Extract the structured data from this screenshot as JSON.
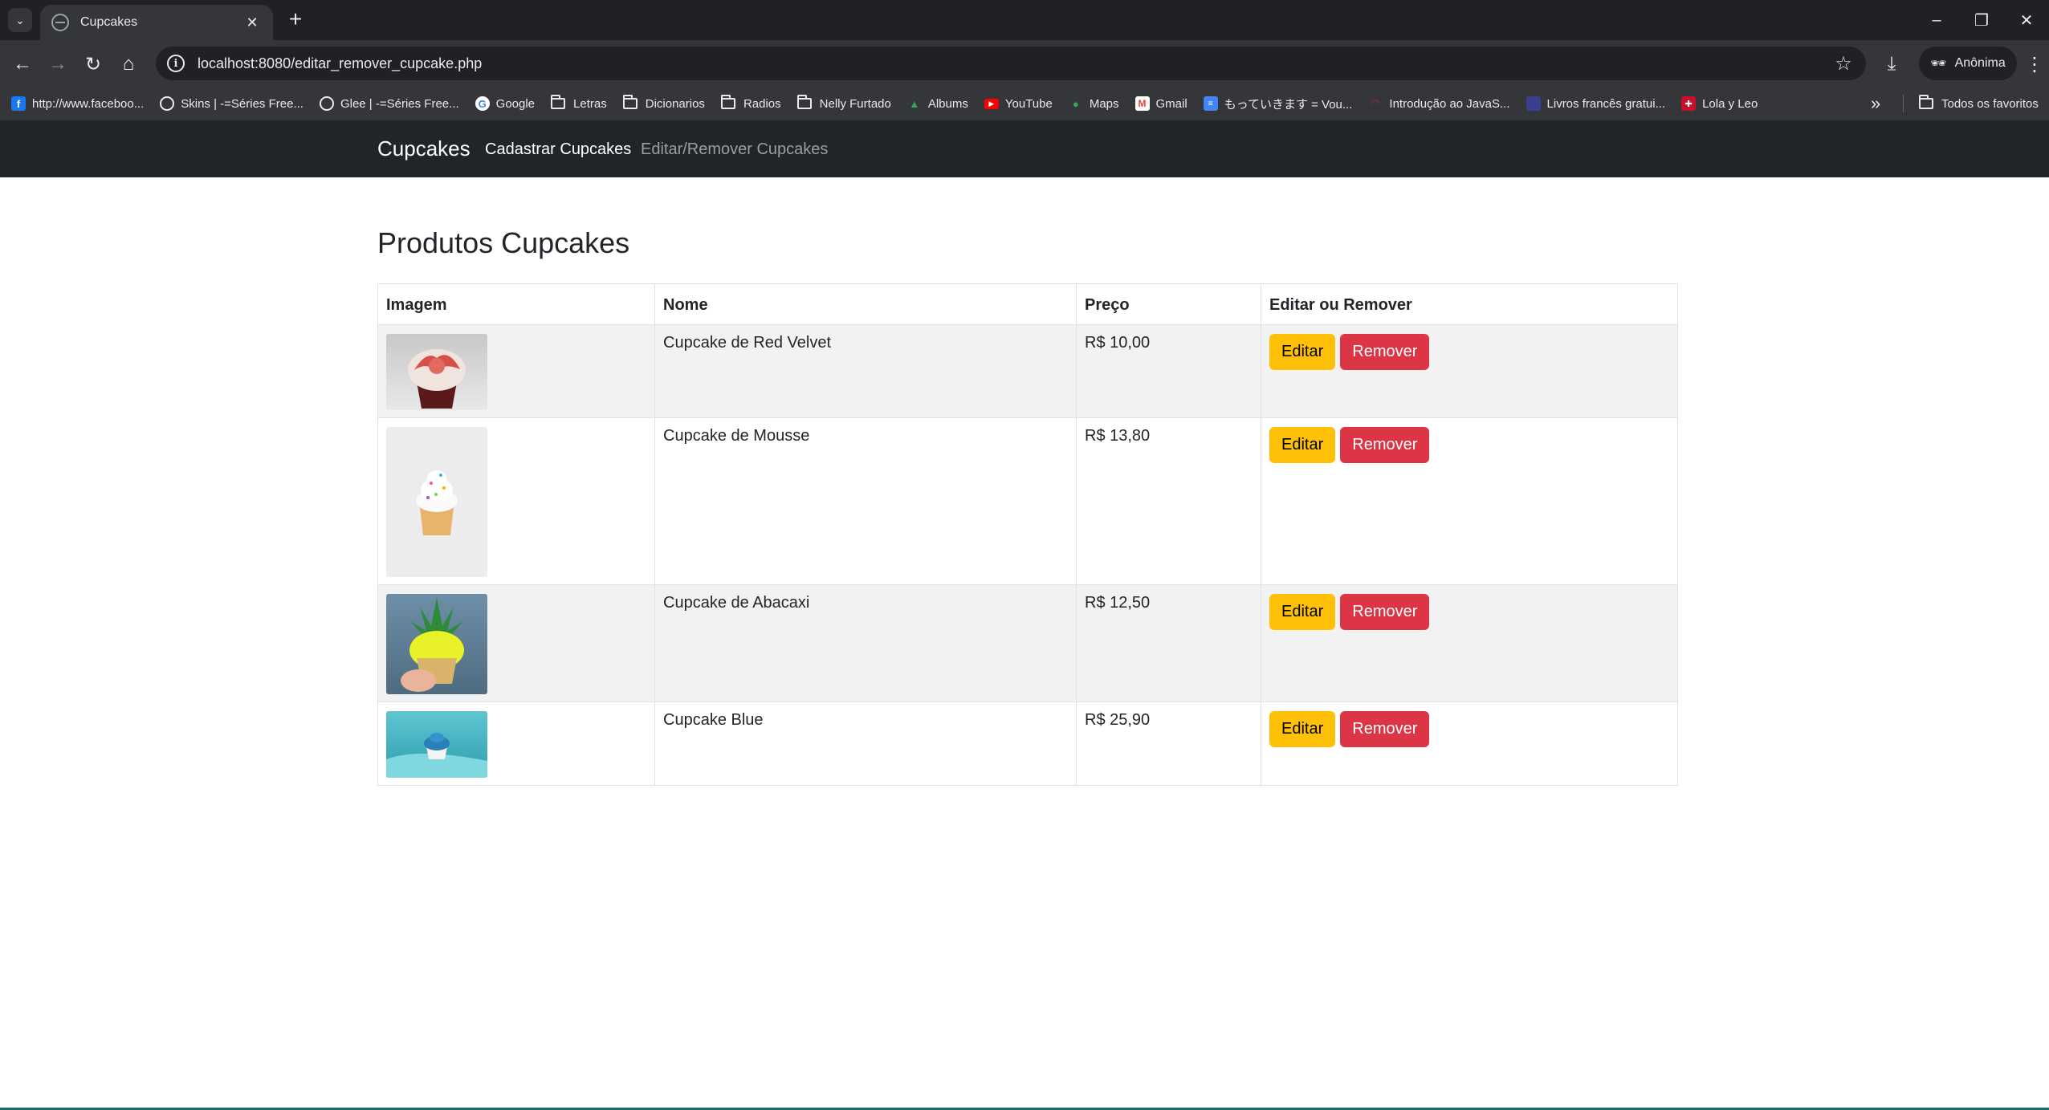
{
  "browser": {
    "tab_title": "Cupcakes",
    "tab_close": "✕",
    "new_tab": "+",
    "url": "localhost:8080/editar_remover_cupcake.php",
    "incognito_label": "Anônima",
    "bookmarks": [
      {
        "label": "http://www.faceboo...",
        "icon": "facebook-icon",
        "color": "#1877f2"
      },
      {
        "label": "Skins | -=Séries Free...",
        "icon": "globe-icon"
      },
      {
        "label": "Glee | -=Séries Free...",
        "icon": "globe-icon"
      },
      {
        "label": "Google",
        "icon": "google-icon"
      },
      {
        "label": "Letras",
        "icon": "folder-icon"
      },
      {
        "label": "Dicionarios",
        "icon": "folder-icon"
      },
      {
        "label": "Radios",
        "icon": "folder-icon"
      },
      {
        "label": "Nelly Furtado",
        "icon": "folder-icon"
      },
      {
        "label": "Albums",
        "icon": "drive-icon"
      },
      {
        "label": "YouTube",
        "icon": "youtube-icon",
        "color": "#ff0000"
      },
      {
        "label": "Maps",
        "icon": "maps-icon"
      },
      {
        "label": "Gmail",
        "icon": "gmail-icon"
      },
      {
        "label": "もっていきます = Vou...",
        "icon": "docs-icon",
        "color": "#4285f4"
      },
      {
        "label": "Introdução ao JavaS...",
        "icon": "site-icon"
      },
      {
        "label": "Livros francês gratui...",
        "icon": "site-icon"
      },
      {
        "label": "Lola y Leo",
        "icon": "uk-flag-icon"
      }
    ],
    "all_bookmarks": "Todos os favoritos"
  },
  "nav": {
    "brand": "Cupcakes",
    "links": [
      {
        "label": "Cadastrar Cupcakes",
        "active": true
      },
      {
        "label": "Editar/Remover Cupcakes",
        "active": false
      }
    ]
  },
  "page": {
    "title": "Produtos Cupcakes",
    "columns": [
      "Imagem",
      "Nome",
      "Preço",
      "Editar ou Remover"
    ],
    "edit_label": "Editar",
    "remove_label": "Remover",
    "products": [
      {
        "name": "Cupcake de Red Velvet",
        "price": "R$ 10,00",
        "image": "red-velvet-cupcake-image"
      },
      {
        "name": "Cupcake de Mousse",
        "price": "R$ 13,80",
        "image": "mousse-cupcake-image"
      },
      {
        "name": "Cupcake de Abacaxi",
        "price": "R$ 12,50",
        "image": "pineapple-cupcake-image"
      },
      {
        "name": "Cupcake Blue",
        "price": "R$ 25,90",
        "image": "blue-cupcake-image"
      }
    ]
  },
  "colors": {
    "navbar_bg": "#212529",
    "warning": "#ffc107",
    "danger": "#dc3545",
    "chrome_dark": "#202124",
    "chrome_toolbar": "#35363a"
  }
}
